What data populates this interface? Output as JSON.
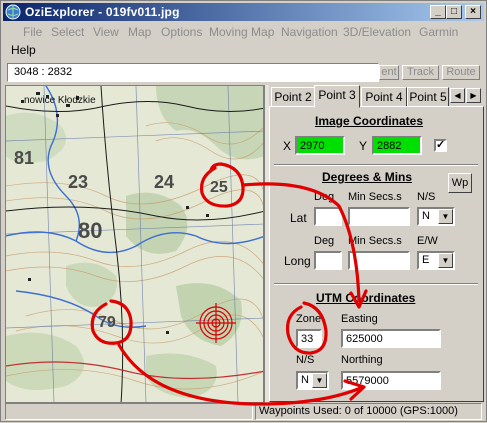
{
  "window": {
    "title": "OziExplorer - 019fv011.jpg",
    "controls": {
      "minimize": "_",
      "maximize": "□",
      "close": "×"
    }
  },
  "menu": {
    "items": [
      "File",
      "Select",
      "View",
      "Map",
      "Options",
      "Moving Map",
      "Navigation",
      "3D/Elevation",
      "Garmin"
    ],
    "help": "Help"
  },
  "toolbar": {
    "coords": "3048 : 2832",
    "buttons": [
      "ent",
      "Track",
      "Route"
    ]
  },
  "map": {
    "town_label": "nowice Kłodzkie",
    "grid_numbers": [
      "81",
      "23",
      "80",
      "24",
      "25",
      "79"
    ],
    "annotated_numbers": [
      "25",
      "79"
    ]
  },
  "tabs": {
    "items": [
      "Point 2",
      "Point 3",
      "Point 4",
      "Point 5"
    ],
    "active": "Point 3"
  },
  "image_coords": {
    "title": "Image Coordinates",
    "x_label": "X",
    "x_value": "2970",
    "y_label": "Y",
    "y_value": "2882",
    "checked_mark": "✓"
  },
  "degrees": {
    "title": "Degrees & Mins",
    "wp_button": "Wp",
    "lat_label": "Lat",
    "long_label": "Long",
    "deg_header": "Deg",
    "min_header": "Min Secs.s",
    "ns_header": "N/S",
    "ew_header": "E/W",
    "lat_hemi": "N",
    "long_hemi": "E"
  },
  "utm": {
    "title": "UTM Coordinates",
    "zone_label": "Zone",
    "zone_value": "33",
    "easting_label": "Easting",
    "easting_value": "625000",
    "ns_label": "N/S",
    "ns_value": "N",
    "northing_label": "Northing",
    "northing_value": "5579000"
  },
  "status": {
    "waypoints": "Waypoints Used: 0 of 10000  (GPS:1000)"
  },
  "colors": {
    "annotation": "#e00000",
    "green_field": "#00e000",
    "title_bar": "#0a246a"
  },
  "icons": {
    "app": "globe-icon",
    "tab_left": "arrow-left-icon",
    "tab_right": "arrow-right-icon",
    "dropdown": "chevron-down-icon"
  }
}
